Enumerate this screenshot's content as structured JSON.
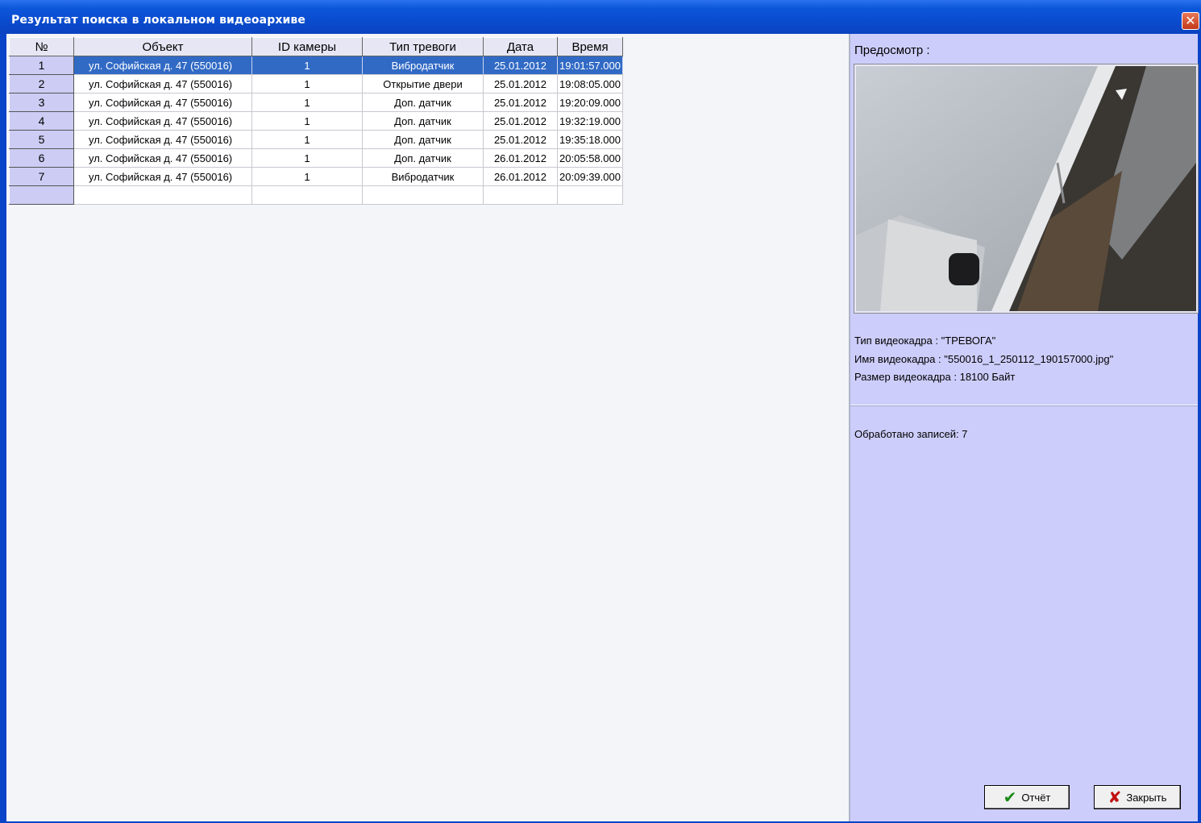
{
  "window": {
    "title": "Результат поиска в локальном видеоархиве",
    "close_glyph": "✕"
  },
  "grid": {
    "columns": [
      "№",
      "Объект",
      "ID камеры",
      "Тип тревоги",
      "Дата",
      "Время"
    ],
    "rows": [
      {
        "num": "1",
        "object": "ул. Софийская д. 47 (550016)",
        "camera_id": "1",
        "alarm_type": "Вибродатчик",
        "date": "25.01.2012",
        "time": "19:01:57.000"
      },
      {
        "num": "2",
        "object": "ул. Софийская д. 47 (550016)",
        "camera_id": "1",
        "alarm_type": "Открытие двери",
        "date": "25.01.2012",
        "time": "19:08:05.000"
      },
      {
        "num": "3",
        "object": "ул. Софийская д. 47 (550016)",
        "camera_id": "1",
        "alarm_type": "Доп. датчик",
        "date": "25.01.2012",
        "time": "19:20:09.000"
      },
      {
        "num": "4",
        "object": "ул. Софийская д. 47 (550016)",
        "camera_id": "1",
        "alarm_type": "Доп. датчик",
        "date": "25.01.2012",
        "time": "19:32:19.000"
      },
      {
        "num": "5",
        "object": "ул. Софийская д. 47 (550016)",
        "camera_id": "1",
        "alarm_type": "Доп. датчик",
        "date": "25.01.2012",
        "time": "19:35:18.000"
      },
      {
        "num": "6",
        "object": "ул. Софийская д. 47 (550016)",
        "camera_id": "1",
        "alarm_type": "Доп. датчик",
        "date": "26.01.2012",
        "time": "20:05:58.000"
      },
      {
        "num": "7",
        "object": "ул. Софийская д. 47 (550016)",
        "camera_id": "1",
        "alarm_type": "Вибродатчик",
        "date": "26.01.2012",
        "time": "20:09:39.000"
      }
    ],
    "selected_row": 0
  },
  "side": {
    "preview_label": "Предосмотр :",
    "frame_type": "Тип видеокадра : \"ТРЕВОГА\"",
    "frame_name": "Имя видеокадра : \"550016_1_250112_190157000.jpg\"",
    "frame_size": "Размер видеокадра : 18100 Байт",
    "processed": "Обработано записей: 7"
  },
  "buttons": {
    "report_label": "Отчёт",
    "report_icon": "check-icon",
    "close_label": "Закрыть",
    "close_icon": "cross-icon"
  },
  "colors": {
    "titlebar": "#0a4ccf",
    "selection": "#316ac5",
    "side_panel": "#cdcdfb"
  }
}
